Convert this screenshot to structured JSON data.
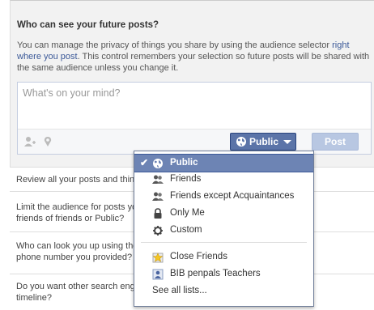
{
  "settings": {
    "future_posts": {
      "title": "Who can see your future posts?",
      "desc_pre": "You can manage the privacy of things you share by using the audience selector",
      "desc_link": "right where you post",
      "desc_post": ". This control remembers your selection so future posts will be shared with the same audience unless you change it."
    },
    "composer": {
      "placeholder": "What's on your mind?",
      "audience_label": "Public",
      "post_label": "Post"
    },
    "rows": [
      {
        "line1": "Review all your posts and things you're tagged in",
        "line2": ""
      },
      {
        "line1": "Limit the audience for posts you've shared with",
        "line2": "friends of friends or Public?"
      },
      {
        "line1": "Who can look you up using the email address or",
        "line2": "phone number you provided?"
      },
      {
        "line1": "Do you want other search engines to link to your",
        "line2": "timeline?"
      }
    ]
  },
  "audience_menu": {
    "items": [
      {
        "label": "Public",
        "icon": "globe-icon",
        "selected": true
      },
      {
        "label": "Friends",
        "icon": "friends-icon"
      },
      {
        "label": "Friends except Acquaintances",
        "icon": "friends-except-icon"
      },
      {
        "label": "Only Me",
        "icon": "lock-icon"
      },
      {
        "label": "Custom",
        "icon": "gear-icon"
      },
      {
        "label": "Close Friends",
        "icon": "star-list-icon"
      },
      {
        "label": "BIB penpals Teachers",
        "icon": "person-list-icon"
      }
    ],
    "see_all": "See all lists..."
  },
  "colors": {
    "accent": "#3b5998",
    "menu_selected": "#6d84b4",
    "audience_button": "#5b74a8"
  }
}
